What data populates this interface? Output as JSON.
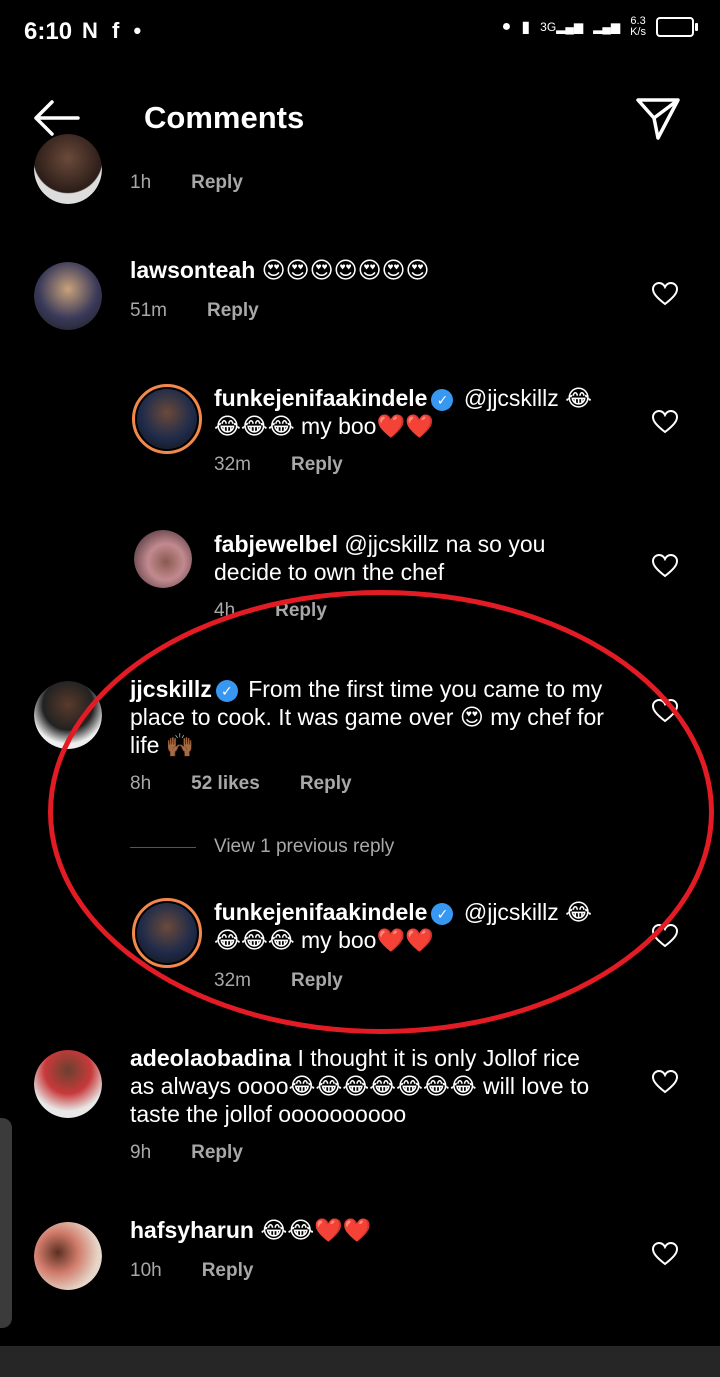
{
  "status": {
    "time": "6:10",
    "left_icons": "N f •",
    "network_speed_top": "6.3",
    "network_speed_bottom": "K/s",
    "signal_label": "3G"
  },
  "header": {
    "title": "Comments"
  },
  "comments": [
    {
      "user": "",
      "text": "",
      "time": "1h",
      "likes": "",
      "reply": "Reply"
    },
    {
      "user": "lawsonteah",
      "text": "😍😍😍😍😍😍😍",
      "time": "51m",
      "likes": "",
      "reply": "Reply"
    },
    {
      "user": "funkejenifaakindele",
      "verified": true,
      "text": "@jjcskillz 😂😂😂😂 my boo❤️❤️",
      "time": "32m",
      "likes": "",
      "reply": "Reply"
    },
    {
      "user": "fabjewelbel",
      "text": "@jjcskillz na so you decide to own the chef",
      "time": "4h",
      "likes": "",
      "reply": "Reply"
    },
    {
      "user": "jjcskillz",
      "verified": true,
      "text": "From the first time you came to my place to cook. It was game over 😍 my chef for life 🙌🏾",
      "time": "8h",
      "likes": "52 likes",
      "reply": "Reply"
    },
    {
      "user": "funkejenifaakindele",
      "verified": true,
      "text": "@jjcskillz 😂😂😂😂 my boo❤️❤️",
      "time": "32m",
      "likes": "",
      "reply": "Reply"
    },
    {
      "user": "adeolaobadina",
      "text": "I thought it is only Jollof rice as always oooo😂😂😂😂😂😂😂 will love to taste the jollof oooooooooo",
      "time": "9h",
      "likes": "",
      "reply": "Reply"
    },
    {
      "user": "hafsyharun",
      "text": "😂😂❤️❤️",
      "time": "10h",
      "likes": "",
      "reply": "Reply"
    }
  ],
  "view_previous": "View 1 previous reply",
  "colors": {
    "background": "#000000",
    "secondary_text": "#a8a8a8",
    "verified_blue": "#3897f0",
    "highlight_red": "#e21b24",
    "story_ring": "#f2884b"
  }
}
